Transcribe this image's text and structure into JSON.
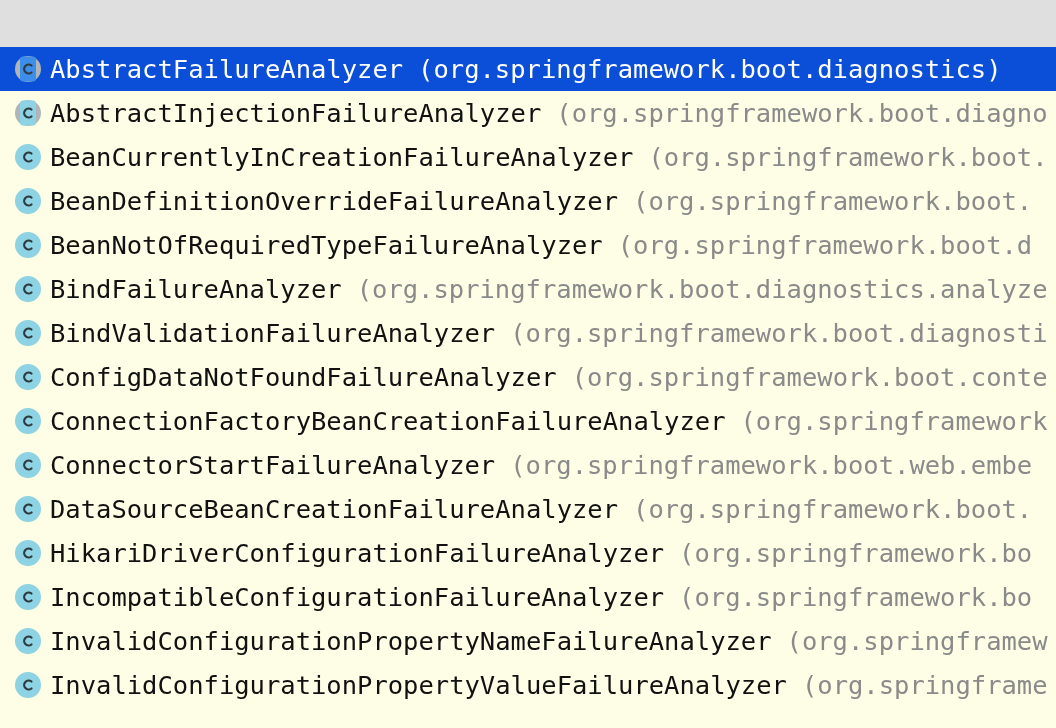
{
  "results": [
    {
      "kind": "abstract",
      "name": "AbstractFailureAnalyzer",
      "package": "(org.springframework.boot.diagnostics)",
      "selected": true
    },
    {
      "kind": "abstract",
      "name": "AbstractInjectionFailureAnalyzer",
      "package": "(org.springframework.boot.diagno",
      "selected": false
    },
    {
      "kind": "class",
      "name": "BeanCurrentlyInCreationFailureAnalyzer",
      "package": "(org.springframework.boot.",
      "selected": false
    },
    {
      "kind": "class",
      "name": "BeanDefinitionOverrideFailureAnalyzer",
      "package": "(org.springframework.boot.",
      "selected": false
    },
    {
      "kind": "class",
      "name": "BeanNotOfRequiredTypeFailureAnalyzer",
      "package": "(org.springframework.boot.d",
      "selected": false
    },
    {
      "kind": "class",
      "name": "BindFailureAnalyzer",
      "package": "(org.springframework.boot.diagnostics.analyze",
      "selected": false
    },
    {
      "kind": "class",
      "name": "BindValidationFailureAnalyzer",
      "package": "(org.springframework.boot.diagnosti",
      "selected": false
    },
    {
      "kind": "class",
      "name": "ConfigDataNotFoundFailureAnalyzer",
      "package": "(org.springframework.boot.conte",
      "selected": false
    },
    {
      "kind": "class",
      "name": "ConnectionFactoryBeanCreationFailureAnalyzer",
      "package": "(org.springframework",
      "selected": false
    },
    {
      "kind": "class",
      "name": "ConnectorStartFailureAnalyzer",
      "package": "(org.springframework.boot.web.embe",
      "selected": false
    },
    {
      "kind": "class",
      "name": "DataSourceBeanCreationFailureAnalyzer",
      "package": "(org.springframework.boot.",
      "selected": false
    },
    {
      "kind": "class",
      "name": "HikariDriverConfigurationFailureAnalyzer",
      "package": "(org.springframework.bo",
      "selected": false
    },
    {
      "kind": "class",
      "name": "IncompatibleConfigurationFailureAnalyzer",
      "package": "(org.springframework.bo",
      "selected": false
    },
    {
      "kind": "class",
      "name": "InvalidConfigurationPropertyNameFailureAnalyzer",
      "package": "(org.springframew",
      "selected": false
    },
    {
      "kind": "class",
      "name": "InvalidConfigurationPropertyValueFailureAnalyzer",
      "package": "(org.springframe",
      "selected": false
    }
  ]
}
